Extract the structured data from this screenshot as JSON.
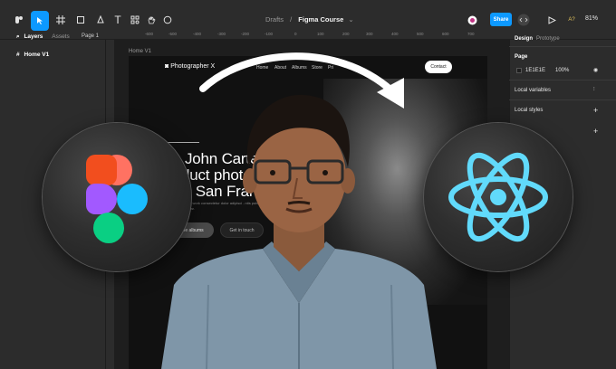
{
  "toolbar": {
    "file_name": "Figma Course",
    "folder": "Drafts",
    "share_label": "Share",
    "zoom": "81%",
    "extra": "A?"
  },
  "left_panel": {
    "tabs": [
      "Layers",
      "Assets"
    ],
    "page_selector": "Page 1",
    "layers": [
      "Home V1"
    ]
  },
  "right_panel": {
    "tabs": [
      "Design",
      "Prototype"
    ],
    "page_section": "Page",
    "page_color_hex": "1E1E1E",
    "page_opacity": "100%",
    "local_variables": "Local variables",
    "local_styles": "Local styles"
  },
  "ruler": [
    "-600",
    "-500",
    "-400",
    "-300",
    "-200",
    "-100",
    "0",
    "100",
    "200",
    "300",
    "400",
    "500",
    "600",
    "700",
    "800",
    "900",
    "1000"
  ],
  "canvas": {
    "frame_label": "Home V1",
    "site": {
      "logo": "Photographer X",
      "nav": [
        "Home",
        "About",
        "Albums",
        "Store",
        "Pri"
      ],
      "contact": "Contact",
      "headline": [
        "John Carte",
        "duct photog",
        "n San Franci"
      ],
      "blurb": "...ur of work consectetur dolor adipisci ..ntis pulvinar, ..ns mattis pulvinar.",
      "buttons": [
        "...ne albums",
        "Get in touch"
      ]
    }
  },
  "colors": {
    "figma_blue": "#0d99ff",
    "panel_bg": "#2c2c2c",
    "canvas_bg": "#1e1e1e",
    "react_cyan": "#61dafb"
  }
}
